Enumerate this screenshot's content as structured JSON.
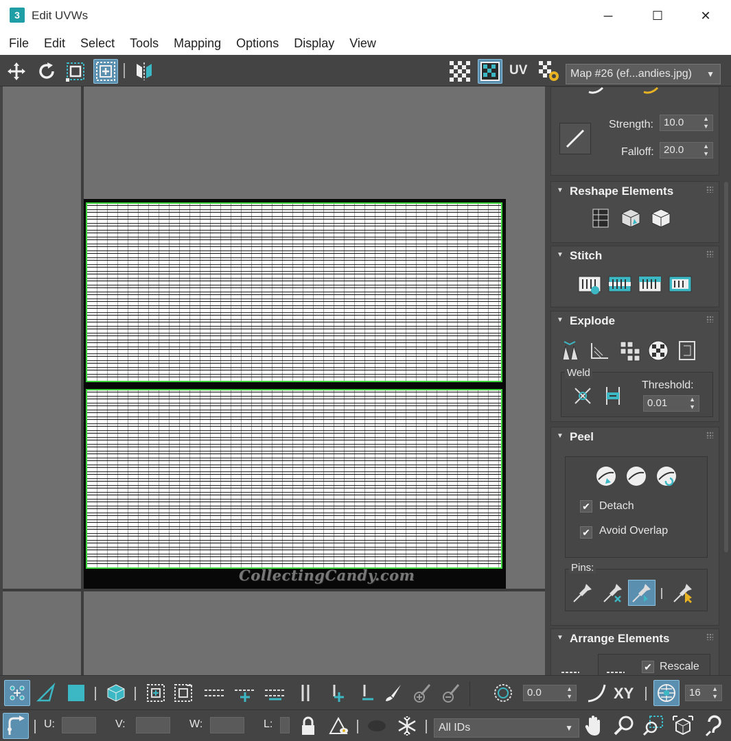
{
  "window": {
    "title": "Edit UVWs",
    "app_icon_label": "3",
    "minimize": "─",
    "maximize": "☐",
    "close": "✕"
  },
  "menu": [
    "File",
    "Edit",
    "Select",
    "Tools",
    "Mapping",
    "Options",
    "Display",
    "View"
  ],
  "toolbar": {
    "uv_label": "UV",
    "map_select": "Map #26 (ef...andies.jpg)"
  },
  "viewport": {
    "watermark": "CollectingCandy.com"
  },
  "panel": {
    "soft_select": {
      "strength_label": "Strength:",
      "strength_value": "10.0",
      "falloff_label": "Falloff:",
      "falloff_value": "20.0"
    },
    "reshape": {
      "title": "Reshape Elements"
    },
    "stitch": {
      "title": "Stitch"
    },
    "explode": {
      "title": "Explode",
      "weld_label": "Weld",
      "threshold_label": "Threshold:",
      "threshold_value": "0.01"
    },
    "peel": {
      "title": "Peel",
      "detach_label": "Detach",
      "avoid_overlap_label": "Avoid Overlap",
      "pins_label": "Pins:"
    },
    "arrange": {
      "title": "Arrange Elements",
      "rescale_label": "Rescale"
    }
  },
  "bottom": {
    "rotation_value": "0.0",
    "xy_label": "XY",
    "grid_value": "16",
    "u_label": "U:",
    "v_label": "V:",
    "w_label": "W:",
    "l_label": "L:",
    "ids_select": "All IDs"
  },
  "colors": {
    "accent": "#3bb8c4",
    "selection_edge": "#3bd43b",
    "active_button": "#5a8fb0"
  }
}
